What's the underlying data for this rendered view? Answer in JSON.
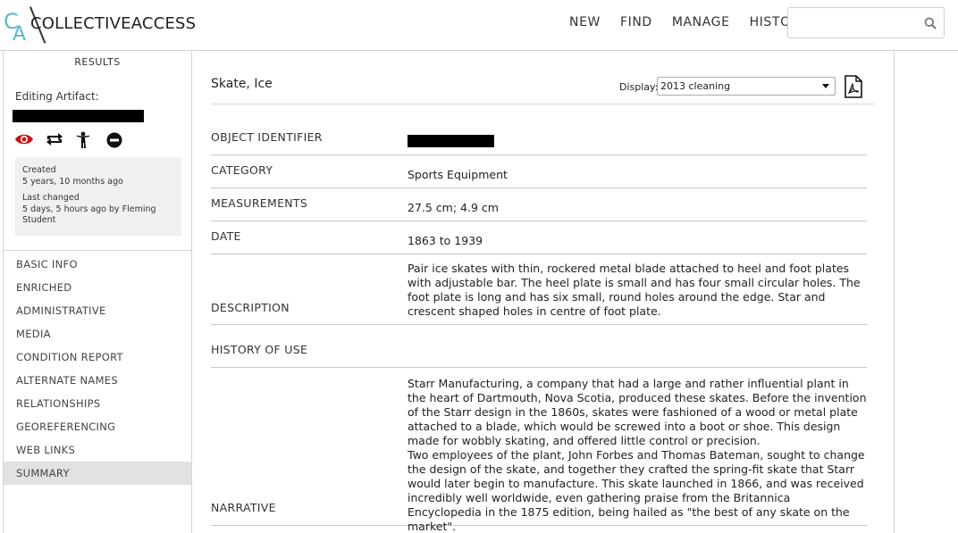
{
  "header": {
    "logo_c": "C",
    "logo_a": "A",
    "logo_text": "COLLECTIVEACCESS",
    "nav": [
      "NEW",
      "FIND",
      "MANAGE",
      "HISTORY"
    ],
    "search_value": "",
    "search_icon": "search-icon"
  },
  "sidebar": {
    "results_label": "RESULTS",
    "editing_label": "Editing Artifact:",
    "action_icons": [
      "eye-icon",
      "repeat-icon",
      "person-icon",
      "no-entry-icon"
    ],
    "icon_colors": {
      "eye": "#cc1111",
      "others": "#111111"
    },
    "created_label": "Created",
    "created_value": "5 years, 10 months ago",
    "changed_label": "Last changed",
    "changed_value": "5 days, 5 hours ago by Fleming Student",
    "menu": [
      {
        "label": "BASIC INFO",
        "active": false
      },
      {
        "label": "ENRICHED",
        "active": false
      },
      {
        "label": "ADMINISTRATIVE",
        "active": false
      },
      {
        "label": "MEDIA",
        "active": false
      },
      {
        "label": "CONDITION REPORT",
        "active": false
      },
      {
        "label": "ALTERNATE NAMES",
        "active": false
      },
      {
        "label": "RELATIONSHIPS",
        "active": false
      },
      {
        "label": "GEOREFERENCING",
        "active": false
      },
      {
        "label": "WEB LINKS",
        "active": false
      },
      {
        "label": "SUMMARY",
        "active": true
      }
    ]
  },
  "main": {
    "title": "Skate, Ice",
    "display_label": "Display:",
    "display_value": "2013 cleaning",
    "pdf_icon": "pdf-icon",
    "fields": {
      "object_identifier": {
        "label": "OBJECT IDENTIFIER"
      },
      "category": {
        "label": "CATEGORY",
        "value": "Sports Equipment"
      },
      "measurements": {
        "label": "MEASUREMENTS",
        "value": "27.5 cm; 4.9 cm"
      },
      "date": {
        "label": "DATE",
        "value": "1863 to 1939"
      },
      "description": {
        "label": "DESCRIPTION",
        "value": "Pair ice skates with thin, rockered metal blade attached to heel and foot plates with adjustable bar. The heel plate is small and has four small circular holes. The foot plate is long and has six small, round holes around the edge. Star and crescent shaped holes in centre of foot plate."
      },
      "history_of_use": {
        "label": "HISTORY OF USE",
        "value": ""
      },
      "narrative": {
        "label": "NARRATIVE",
        "value_p1": "Starr Manufacturing, a company that had a large and rather influential plant in the heart of Dartmouth, Nova Scotia, produced these skates. Before the invention of the Starr design in the 1860s, skates were fashioned of a wood or metal plate attached to a blade, which would be screwed into a boot or shoe. This design made for wobbly skating, and offered little control or precision.",
        "value_p2": "Two employees of the plant, John Forbes and Thomas Bateman, sought to change the design of the skate, and together they crafted the spring-fit skate that Starr would later begin to manufacture. This skate launched in 1866, and was received incredibly well worldwide, even gathering praise from the Britannica Encyclopedia in the 1875 edition, being hailed as \"the best of any skate on the market\"."
      }
    }
  }
}
